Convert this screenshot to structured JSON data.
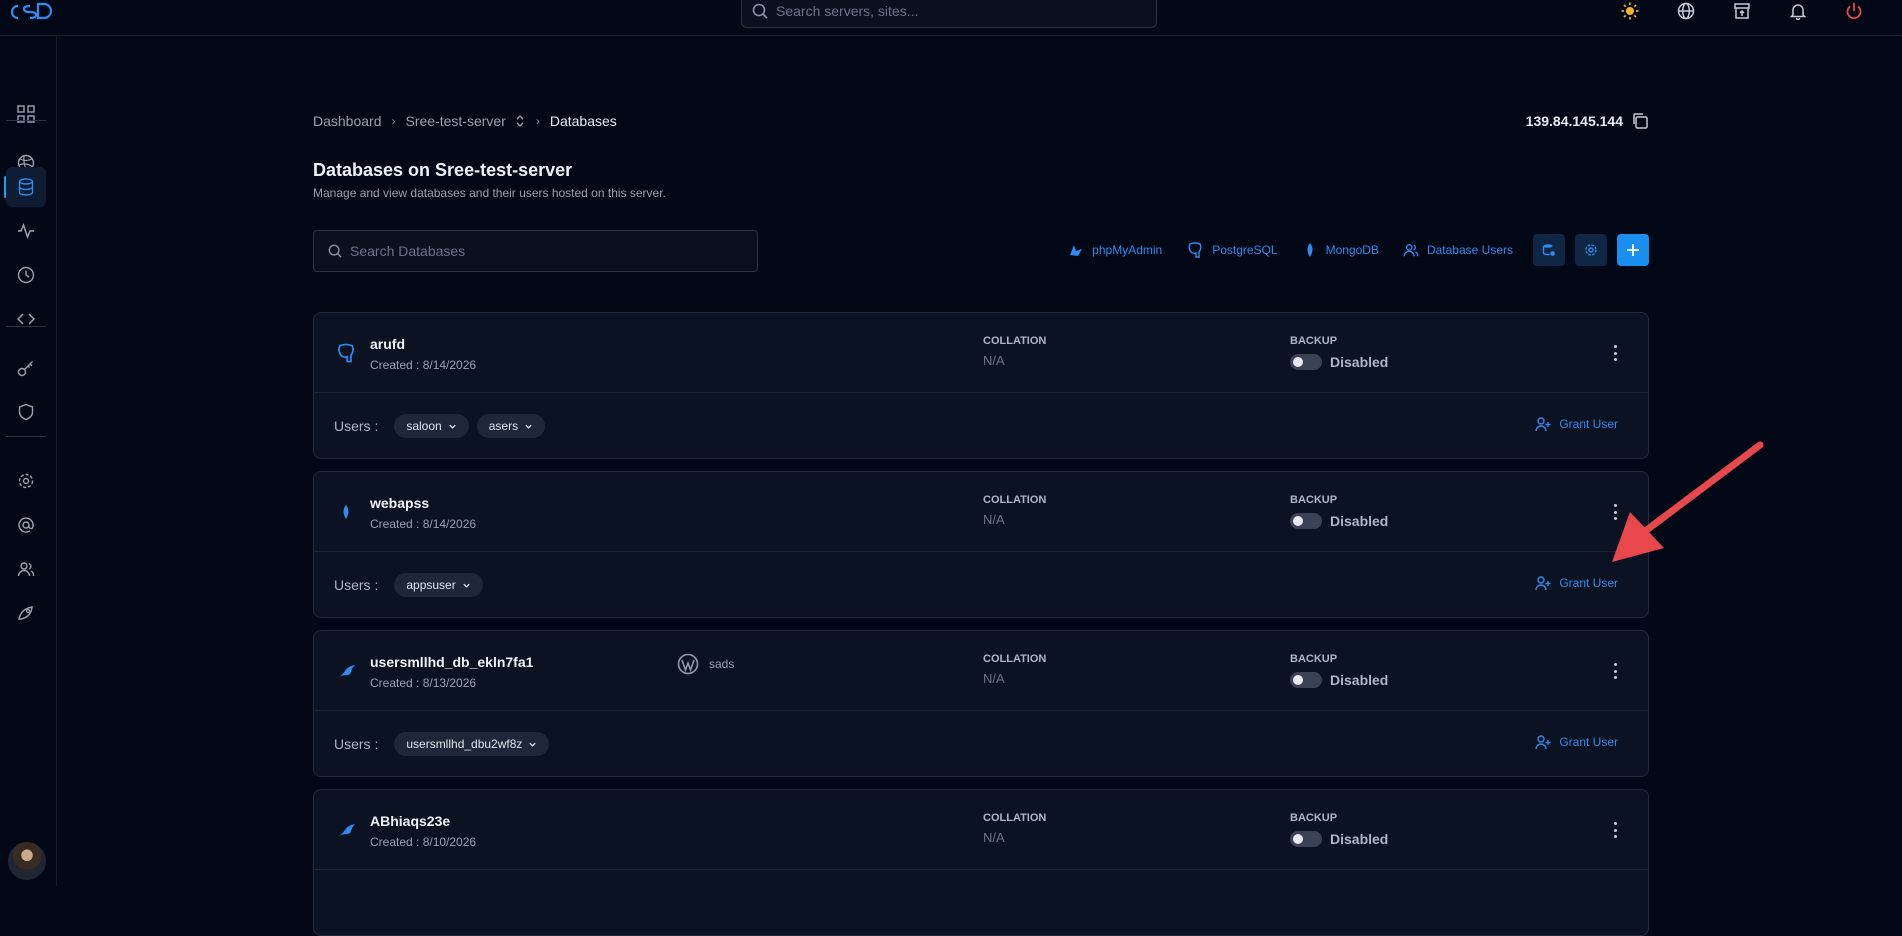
{
  "topbar": {
    "search_placeholder": "Search servers, sites...",
    "icons": [
      "sun-icon",
      "globe-icon",
      "archive-icon",
      "bell-icon",
      "power-icon"
    ]
  },
  "sidebar": {
    "items": [
      "dashboard-icon",
      "server-icon",
      "database-icon",
      "activity-icon",
      "clock-icon",
      "code-icon",
      "key-icon",
      "shield-icon",
      "settings-icon",
      "at-icon",
      "users-icon",
      "deploy-icon"
    ],
    "active": "database-icon"
  },
  "breadcrumb": {
    "home": "Dashboard",
    "server": "Sree-test-server",
    "current": "Databases"
  },
  "server_ip": "139.84.145.144",
  "page": {
    "title": "Databases on Sree-test-server",
    "subtitle": "Manage and view databases and their users hosted on this server."
  },
  "db_search_placeholder": "Search Databases",
  "toolbar": {
    "phpmyadmin": "phpMyAdmin",
    "postgresql": "PostgreSQL",
    "mongodb": "MongoDB",
    "database_users": "Database Users"
  },
  "labels": {
    "collation": "COLLATION",
    "backup": "BACKUP",
    "users": "Users :",
    "grant_user": "Grant User"
  },
  "colors": {
    "accent": "#2f8cf0",
    "background": "#030816",
    "card": "#0b1222",
    "arrow": "#e8474c"
  },
  "databases": [
    {
      "name": "arufd",
      "created": "Created : 8/14/2026",
      "engine": "postgresql",
      "collation": "N/A",
      "backup": "Disabled",
      "site": "",
      "users": [
        "saloon",
        "asers"
      ]
    },
    {
      "name": "webapss",
      "created": "Created : 8/14/2026",
      "engine": "mongodb",
      "collation": "N/A",
      "backup": "Disabled",
      "site": "",
      "users": [
        "appsuser"
      ]
    },
    {
      "name": "usersmllhd_db_ekln7fa1",
      "created": "Created : 8/13/2026",
      "engine": "mysql",
      "collation": "N/A",
      "backup": "Disabled",
      "site": "sads",
      "users": [
        "usersmllhd_dbu2wf8z"
      ]
    },
    {
      "name": "ABhiaqs23e",
      "created": "Created : 8/10/2026",
      "engine": "mysql",
      "collation": "N/A",
      "backup": "Disabled",
      "site": "",
      "users": []
    }
  ]
}
